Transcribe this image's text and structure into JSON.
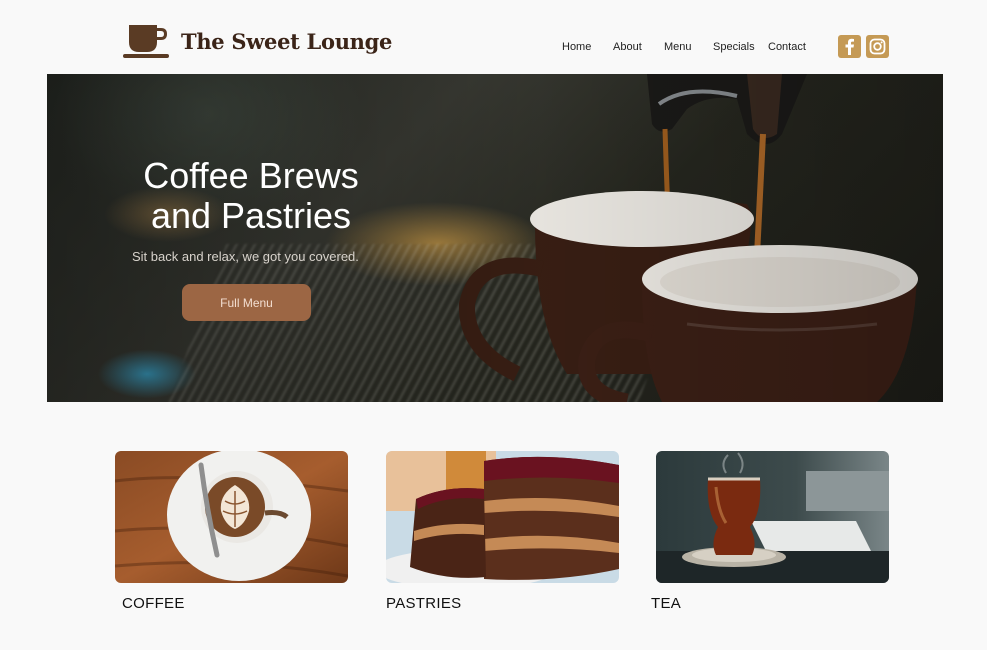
{
  "brand": {
    "name": "The Sweet Lounge",
    "icon": "coffee-cup-icon"
  },
  "nav": {
    "items": [
      {
        "label": "Home"
      },
      {
        "label": "About"
      },
      {
        "label": "Menu"
      },
      {
        "label": "Specials"
      },
      {
        "label": "Contact"
      }
    ]
  },
  "socials": [
    {
      "icon": "facebook-icon"
    },
    {
      "icon": "instagram-icon"
    }
  ],
  "hero": {
    "title_line1": "Coffee Brews",
    "title_line2": "and Pastries",
    "subtitle": "Sit back and relax, we got you covered.",
    "button_label": "Full Menu"
  },
  "categories": [
    {
      "label": "COFFEE"
    },
    {
      "label": "PASTRIES"
    },
    {
      "label": "TEA"
    }
  ],
  "colors": {
    "accent": "#c59a55",
    "button": "#9c6644",
    "brand_text": "#3b2418",
    "background": "#f9f9f9"
  }
}
